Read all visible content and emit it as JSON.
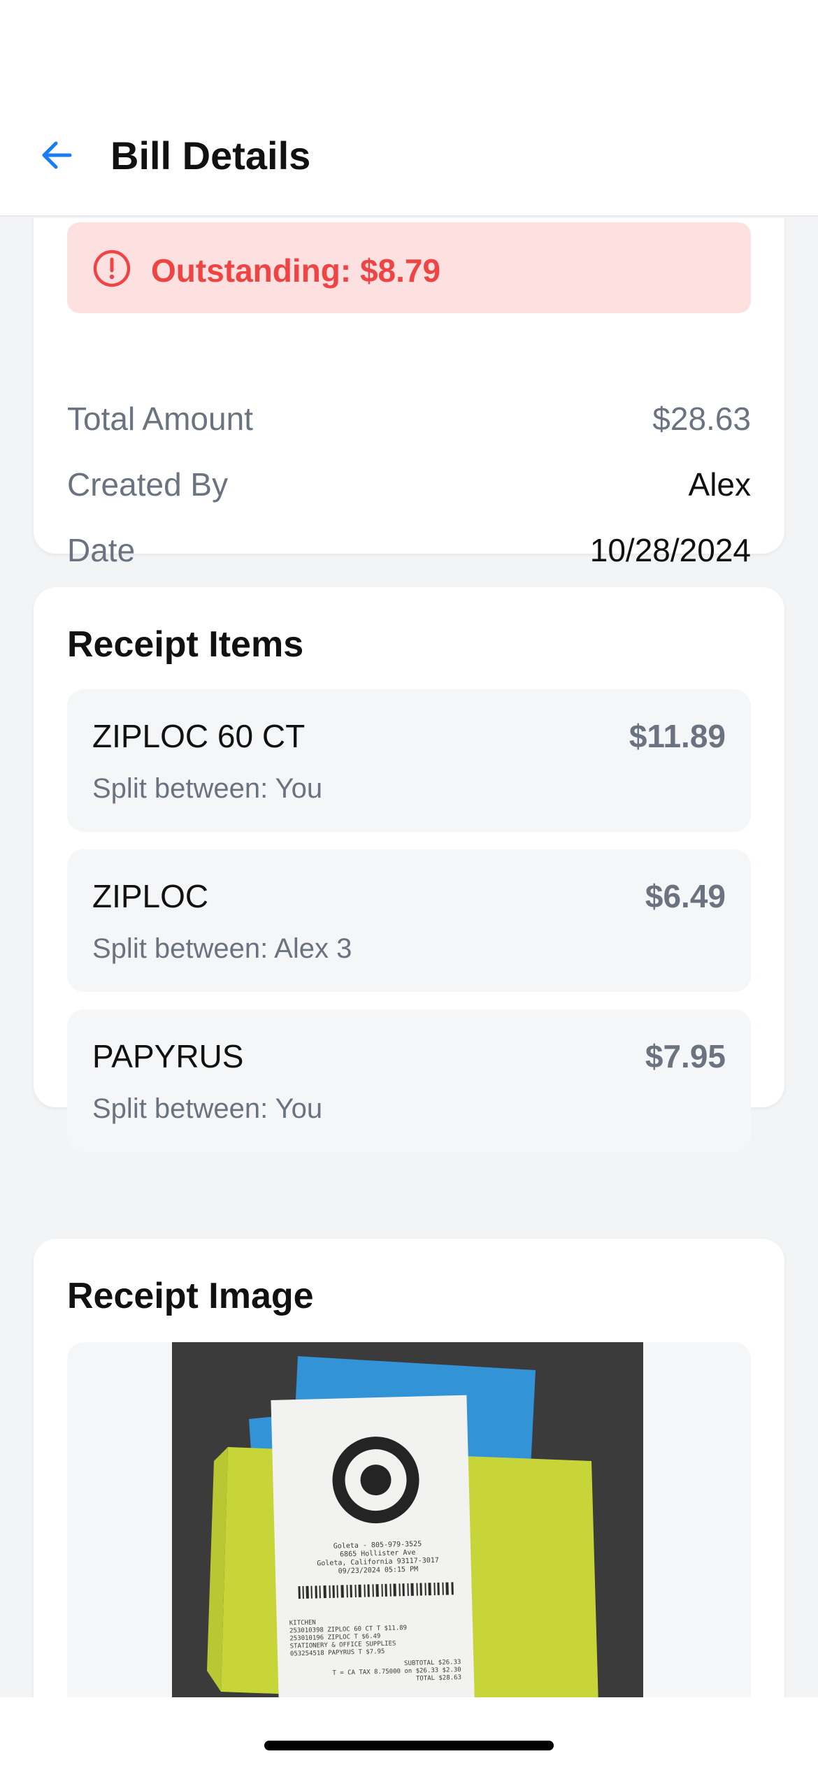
{
  "header": {
    "title": "Bill Details"
  },
  "summary": {
    "outstanding_label": "Outstanding: $8.79",
    "rows": [
      {
        "label": "Total Amount",
        "value": "$28.63"
      },
      {
        "label": "Created By",
        "value": "Alex"
      },
      {
        "label": "Date",
        "value": "10/28/2024"
      }
    ]
  },
  "receipt_items": {
    "title": "Receipt Items",
    "items": [
      {
        "name": "ZIPLOC 60 CT",
        "price": "$11.89",
        "split": "Split between: You"
      },
      {
        "name": "ZIPLOC",
        "price": "$6.49",
        "split": "Split between: Alex 3"
      },
      {
        "name": "PAPYRUS",
        "price": "$7.95",
        "split": "Split between: You"
      }
    ]
  },
  "receipt_image": {
    "title": "Receipt Image",
    "store_phone": "Goleta - 805-979-3525",
    "address_line1": "6865 Hollister Ave",
    "address_line2": "Goleta, California 93117-3017",
    "datetime": "09/23/2024 05:15 PM",
    "lines": [
      "KITCHEN",
      "253010398 ZIPLOC 60 CT     T  $11.89",
      "253010196 ZIPLOC           T   $6.49",
      "STATIONERY & OFFICE SUPPLIES",
      "053254518 PAPYRUS          T   $7.95",
      "SUBTOTAL  $26.33",
      "T = CA TAX 8.75000 on $26.33  $2.30",
      "TOTAL  $28.63"
    ]
  },
  "colors": {
    "accent": "#1a7cf5",
    "danger": "#ef4444",
    "danger_bg": "#fde1e1",
    "muted": "#6b7280",
    "page_bg": "#f3f4f6"
  },
  "icons": {
    "back": "arrow-left-icon",
    "alert": "alert-circle-icon"
  }
}
